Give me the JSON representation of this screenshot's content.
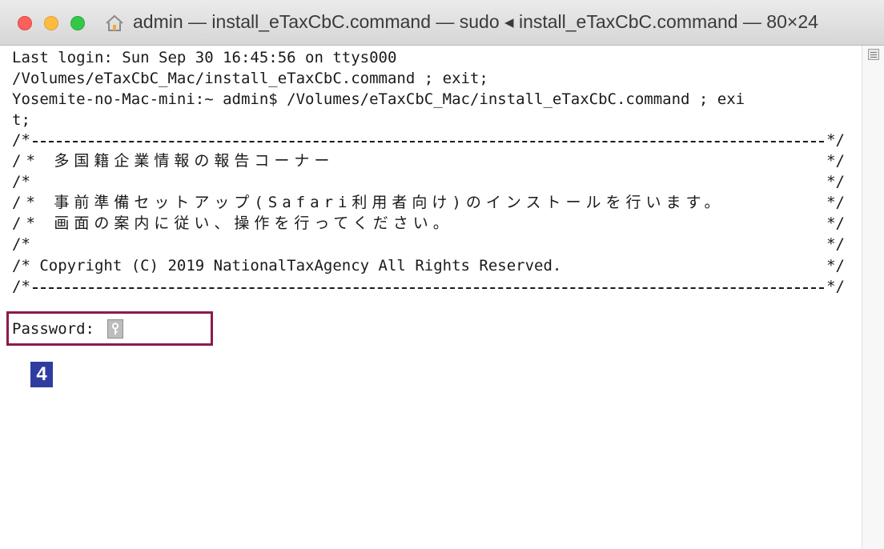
{
  "window": {
    "title": "admin — install_eTaxCbC.command — sudo ◂ install_eTaxCbC.command — 80×24",
    "icon": "home-icon"
  },
  "terminal": {
    "lines": [
      "Last login: Sun Sep 30 16:45:56 on ttys000",
      "/Volumes/eTaxCbC_Mac/install_eTaxCbC.command ; exit;",
      "Yosemite-no-Mac-mini:~ admin$ /Volumes/eTaxCbC_Mac/install_eTaxCbC.command ; exi",
      "t;"
    ],
    "banner": {
      "start": "/*",
      "end": "*/",
      "rule_end": "*/",
      "line_title": "/* 多国籍企業情報の報告コーナー",
      "line_blank": "/*",
      "line_setup": "/* 事前準備セットアップ(Safari利用者向け)のインストールを行います。",
      "line_guide": "/* 画面の案内に従い、操作を行ってください。",
      "line_copyright": "/* Copyright (C) 2019 NationalTaxAgency All Rights Reserved."
    },
    "prompt": {
      "label": "Password:",
      "cursor_icon": "key-icon"
    }
  },
  "annotation": {
    "step_number": "4",
    "highlight_color": "#8b1c4b",
    "badge_color": "#2f3d9e"
  },
  "scrollbar": {
    "icon": "scroll-lines-icon"
  }
}
